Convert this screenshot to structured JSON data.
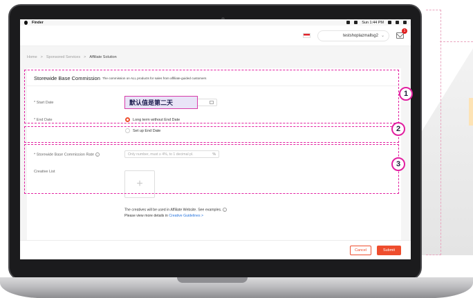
{
  "menubar": {
    "app_name": "Finder",
    "clock": "Sun 1:44 PM"
  },
  "header": {
    "account_name": "testshoplazmallsg2",
    "notification_count": "1"
  },
  "breadcrumb": {
    "items": [
      "Home",
      ">",
      "Sponsored Services",
      ">",
      "Affiliate Solution"
    ]
  },
  "section": {
    "title": "Storewide Base Commission",
    "description": "The commission on ALL products for sales from affiliate-guided customers"
  },
  "form": {
    "start_date_label": "* Start Date",
    "end_date_label": "* End Date",
    "end_date_option_1": "Long term without End Date",
    "end_date_option_2": "Set up End Date",
    "rate_label": "* Storewide Base Commission Rate",
    "rate_placeholder": "Only number, must ≥ 4%, to 1 decimal pl.",
    "rate_unit": "%",
    "creative_label": "Creative List",
    "upload_symbol": "+",
    "creative_note": "The creatives will be used in Affiliate Website. See examples.",
    "creative_more_prefix": "Please view more details in",
    "creative_more_link": "Creative Guidelines >"
  },
  "callout": {
    "text": "默认值是第二天"
  },
  "annotations": [
    "1",
    "2",
    "3"
  ],
  "footer": {
    "cancel_label": "Cancel",
    "submit_label": "Submit"
  },
  "colors": {
    "accent": "#ee4d2d",
    "annotation": "#e21fa0",
    "link": "#2673dd"
  }
}
